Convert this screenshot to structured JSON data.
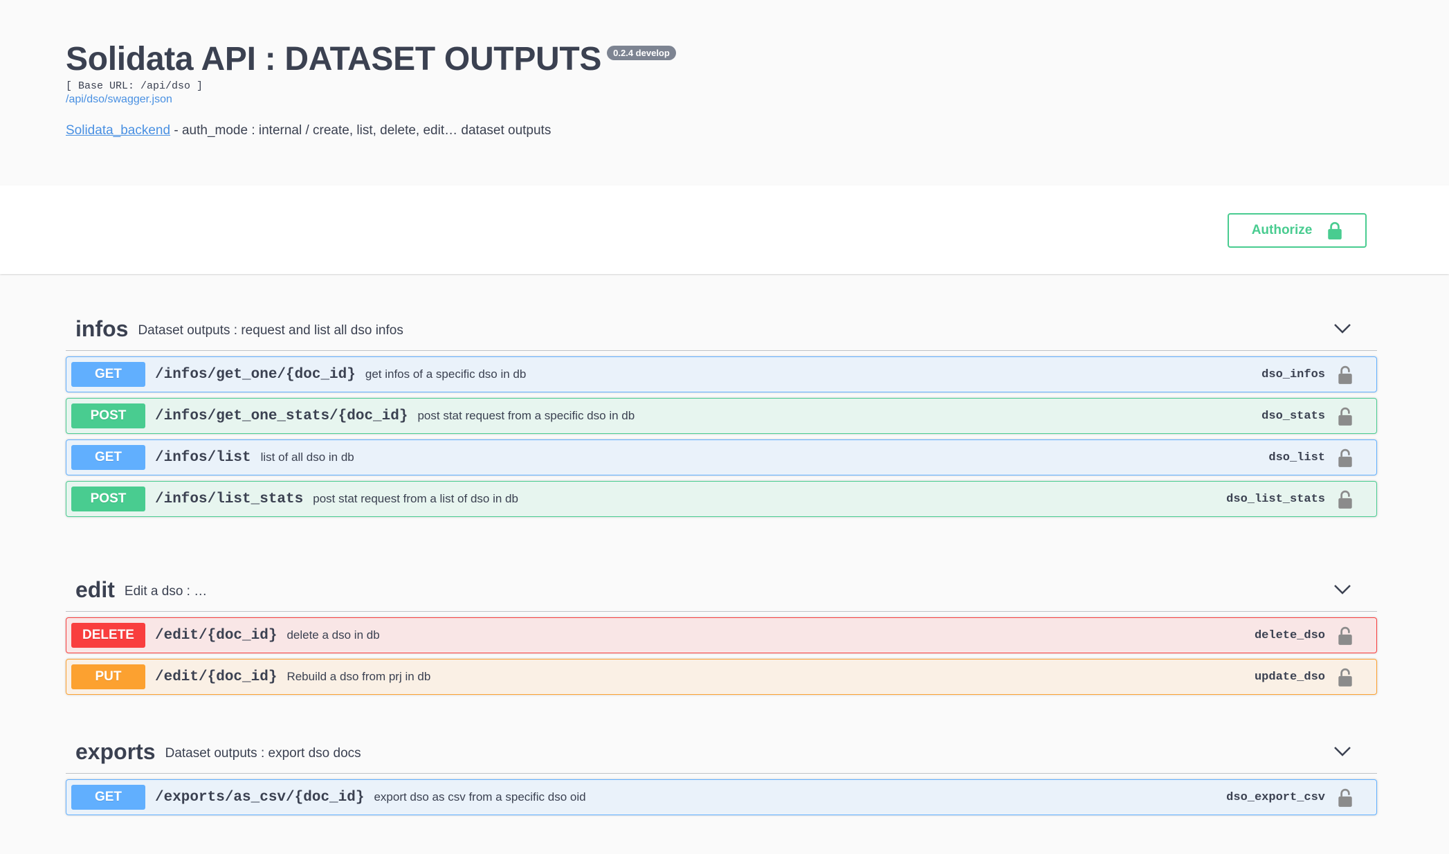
{
  "info": {
    "title": "Solidata API : DATASET OUTPUTS",
    "version": "0.2.4 develop",
    "base_url": "[ Base URL: /api/dso ]",
    "swagger_link": "/api/dso/swagger.json",
    "description_link": "Solidata_backend",
    "description_text": " - auth_mode : internal / create, list, delete, edit… dataset outputs"
  },
  "authorize": {
    "label": "Authorize",
    "icon": "lock-icon"
  },
  "colors": {
    "get": "#61affe",
    "post": "#49cc90",
    "delete": "#f93e3e",
    "put": "#fca130"
  },
  "tags": [
    {
      "name": "infos",
      "description": "Dataset outputs : request and list all dso infos",
      "operations": [
        {
          "method": "GET",
          "path": "/infos/get_one/{doc_id}",
          "summary": "get infos of a specific dso in db",
          "operation_id": "dso_infos"
        },
        {
          "method": "POST",
          "path": "/infos/get_one_stats/{doc_id}",
          "summary": "post stat request from a specific dso in db",
          "operation_id": "dso_stats"
        },
        {
          "method": "GET",
          "path": "/infos/list",
          "summary": "list of all dso in db",
          "operation_id": "dso_list"
        },
        {
          "method": "POST",
          "path": "/infos/list_stats",
          "summary": "post stat request from a list of dso in db",
          "operation_id": "dso_list_stats"
        }
      ]
    },
    {
      "name": "edit",
      "description": "Edit a dso : …",
      "operations": [
        {
          "method": "DELETE",
          "path": "/edit/{doc_id}",
          "summary": "delete a dso in db",
          "operation_id": "delete_dso"
        },
        {
          "method": "PUT",
          "path": "/edit/{doc_id}",
          "summary": "Rebuild a dso from prj in db",
          "operation_id": "update_dso"
        }
      ]
    },
    {
      "name": "exports",
      "description": "Dataset outputs : export dso docs",
      "operations": [
        {
          "method": "GET",
          "path": "/exports/as_csv/{doc_id}",
          "summary": "export dso as csv from a specific dso oid",
          "operation_id": "dso_export_csv"
        }
      ]
    }
  ]
}
